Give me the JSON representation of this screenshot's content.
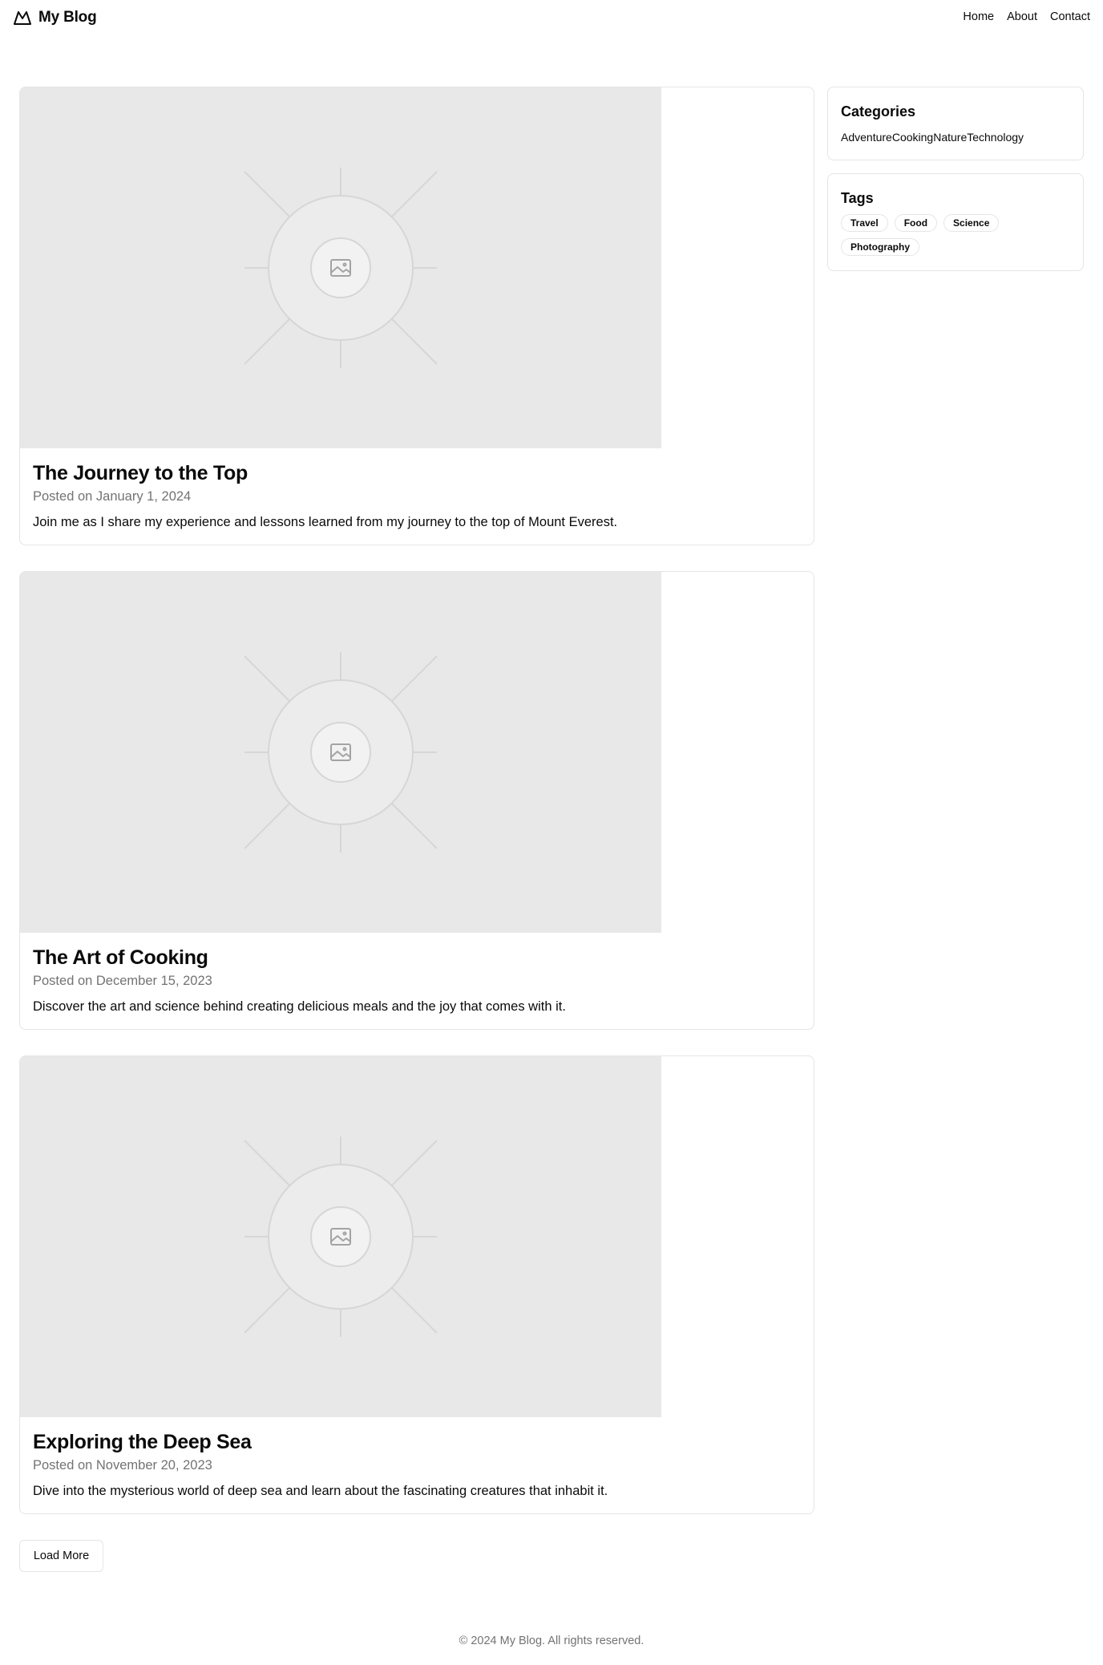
{
  "header": {
    "brand": "My Blog",
    "nav": [
      "Home",
      "About",
      "Contact"
    ]
  },
  "posts": [
    {
      "title": "The Journey to the Top",
      "date": "Posted on January 1, 2024",
      "excerpt": "Join me as I share my experience and lessons learned from my journey to the top of Mount Everest."
    },
    {
      "title": "The Art of Cooking",
      "date": "Posted on December 15, 2023",
      "excerpt": "Discover the art and science behind creating delicious meals and the joy that comes with it."
    },
    {
      "title": "Exploring the Deep Sea",
      "date": "Posted on November 20, 2023",
      "excerpt": "Dive into the mysterious world of deep sea and learn about the fascinating creatures that inhabit it."
    }
  ],
  "load_more_label": "Load More",
  "sidebar": {
    "categories_title": "Categories",
    "categories": [
      "Adventure",
      "Cooking",
      "Nature",
      "Technology"
    ],
    "tags_title": "Tags",
    "tags": [
      "Travel",
      "Food",
      "Science",
      "Photography"
    ]
  },
  "footer": {
    "text": "© 2024 My Blog. All rights reserved."
  },
  "colors": {
    "placeholder_bg": "#e8e8e8",
    "border": "#e5e5e5",
    "muted_text": "#737373",
    "text": "#0a0a0a"
  },
  "icons": {
    "logo": "mountain-icon",
    "image_placeholder": "image-icon"
  }
}
